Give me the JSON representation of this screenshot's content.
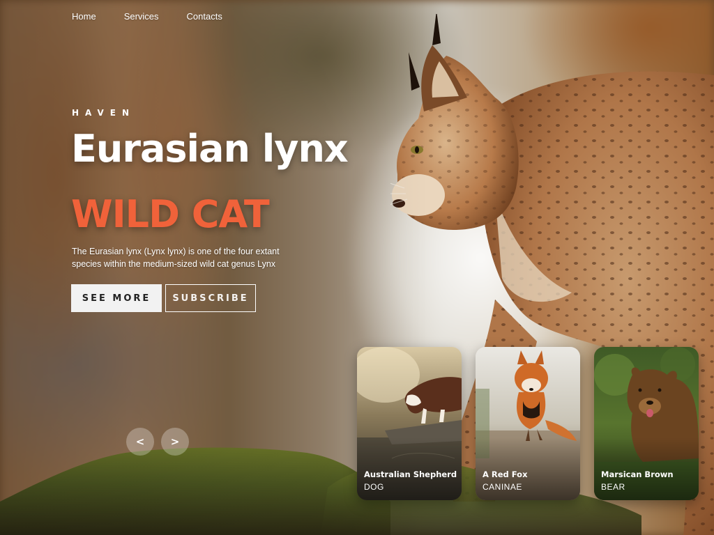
{
  "nav": {
    "items": [
      "Home",
      "Services",
      "Contacts"
    ]
  },
  "hero": {
    "brand": "HAVEN",
    "title": "Eurasian lynx",
    "subtitle": "WILD CAT",
    "description": "The Eurasian lynx (Lynx lynx) is one of the four extant species within the medium-sized wild cat genus Lynx",
    "primary_button": "SEE MORE",
    "secondary_button": "SUBSCRIBE",
    "accent_color": "#f0623a"
  },
  "slider": {
    "prev_label": "<",
    "next_label": ">"
  },
  "cards": [
    {
      "name": "Australian Shepherd",
      "category": "DOG"
    },
    {
      "name": "A Red Fox",
      "category": "CANINAE"
    },
    {
      "name": "Marsican Brown",
      "category": "BEAR"
    }
  ]
}
